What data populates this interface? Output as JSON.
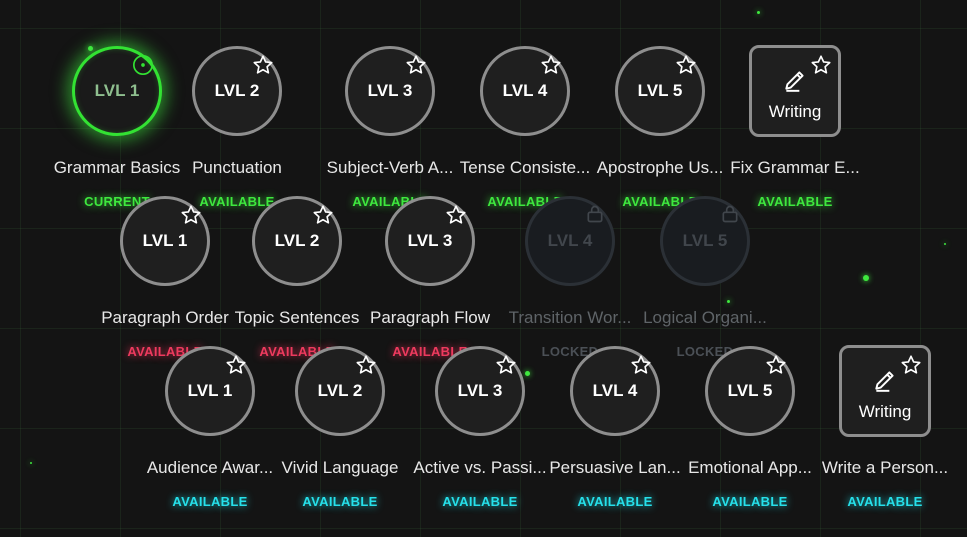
{
  "colors": {
    "green": "#3ee83e",
    "red": "#ee3a5e",
    "cyan": "#26e0ea",
    "locked": "#4b5056"
  },
  "rows": [
    {
      "nodes": [
        {
          "label": "LVL 1",
          "title": "Grammar Basics",
          "status": "CURRENT",
          "state": "current",
          "badge": "ring-icon"
        },
        {
          "label": "LVL 2",
          "title": "Punctuation",
          "status": "AVAILABLE",
          "state": "available",
          "badge": "star-icon"
        },
        {
          "label": "LVL 3",
          "title": "Subject-Verb A...",
          "status": "AVAILABLE",
          "state": "available",
          "badge": "star-icon"
        },
        {
          "label": "LVL 4",
          "title": "Tense Consiste...",
          "status": "AVAILABLE",
          "state": "available",
          "badge": "star-icon"
        },
        {
          "label": "LVL 5",
          "title": "Apostrophe Us...",
          "status": "AVAILABLE",
          "state": "available",
          "badge": "star-icon"
        },
        {
          "label": "Writing",
          "title": "Fix Grammar E...",
          "status": "AVAILABLE",
          "state": "writing",
          "badge": "star-icon"
        }
      ]
    },
    {
      "nodes": [
        {
          "label": "LVL 1",
          "title": "Paragraph Order",
          "status": "AVAILABLE",
          "state": "available",
          "badge": "star-icon"
        },
        {
          "label": "LVL 2",
          "title": "Topic Sentences",
          "status": "AVAILABLE",
          "state": "available",
          "badge": "star-icon"
        },
        {
          "label": "LVL 3",
          "title": "Paragraph Flow",
          "status": "AVAILABLE",
          "state": "available",
          "badge": "star-icon"
        },
        {
          "label": "LVL 4",
          "title": "Transition Wor...",
          "status": "LOCKED",
          "state": "locked",
          "badge": "lock-icon"
        },
        {
          "label": "LVL 5",
          "title": "Logical Organi...",
          "status": "LOCKED",
          "state": "locked",
          "badge": "lock-icon"
        }
      ]
    },
    {
      "nodes": [
        {
          "label": "LVL 1",
          "title": "Audience Awar...",
          "status": "AVAILABLE",
          "state": "available",
          "badge": "star-icon"
        },
        {
          "label": "LVL 2",
          "title": "Vivid Language",
          "status": "AVAILABLE",
          "state": "available",
          "badge": "star-icon"
        },
        {
          "label": "LVL 3",
          "title": "Active vs. Passi...",
          "status": "AVAILABLE",
          "state": "available",
          "badge": "star-icon"
        },
        {
          "label": "LVL 4",
          "title": "Persuasive Lan...",
          "status": "AVAILABLE",
          "state": "available",
          "badge": "star-icon"
        },
        {
          "label": "LVL 5",
          "title": "Emotional App...",
          "status": "AVAILABLE",
          "state": "available",
          "badge": "star-icon"
        },
        {
          "label": "Writing",
          "title": "Write a Person...",
          "status": "AVAILABLE",
          "state": "writing",
          "badge": "star-icon"
        }
      ]
    }
  ]
}
